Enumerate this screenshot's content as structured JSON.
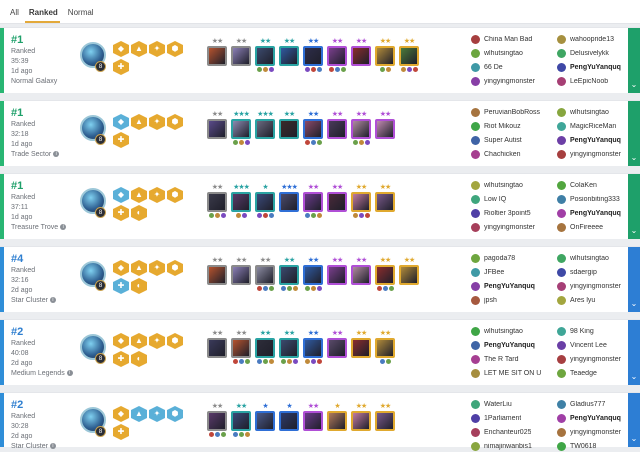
{
  "tabs": [
    "All",
    "Ranked",
    "Normal"
  ],
  "active_tab": 1,
  "colors": {
    "win": "#29b673",
    "loss": "#2f8ed8",
    "place_win": "#1ea06a",
    "place_loss": "#2f7fd0",
    "side_win": "#1ea06a",
    "side_loss": "#2d7ed4"
  },
  "matches": [
    {
      "place": "#1",
      "mode": "Ranked",
      "duration": "35:39",
      "ago": "1d ago",
      "galaxy": "Normal Galaxy",
      "galaxy_info": false,
      "result": "win",
      "level": "8",
      "traits": [
        {
          "icon": "hex-icon",
          "color": "#e6a92f"
        },
        {
          "icon": "hex-icon",
          "color": "#e6a92f"
        },
        {
          "icon": "hex-icon",
          "color": "#e6a92f"
        },
        {
          "icon": "hex-icon",
          "color": "#e6a92f"
        },
        {
          "icon": "hex-icon",
          "color": "#e6a92f"
        }
      ],
      "units": [
        {
          "stars": "★★",
          "color": "#8b8b8b",
          "portrait": "#b5532e",
          "items": 0
        },
        {
          "stars": "★★",
          "color": "#8b8b8b",
          "portrait": "#8a7fb5",
          "items": 0
        },
        {
          "stars": "★★",
          "color": "#2aa3a3",
          "portrait": "#3b4a6e",
          "items": 3
        },
        {
          "stars": "★★",
          "color": "#2aa3a3",
          "portrait": "#2f5aa0",
          "items": 0
        },
        {
          "stars": "★★",
          "color": "#2f6fd6",
          "portrait": "#2d2d4a",
          "items": 3
        },
        {
          "stars": "★★",
          "color": "#b04fd6",
          "portrait": "#7a3f8c",
          "items": 3
        },
        {
          "stars": "★★",
          "color": "#b04fd6",
          "portrait": "#8a2d2d",
          "items": 0
        },
        {
          "stars": "★★",
          "color": "#e0a92f",
          "portrait": "#b08a3a",
          "items": 2
        },
        {
          "stars": "★★",
          "color": "#e0a92f",
          "portrait": "#4a7a3a",
          "items": 3
        }
      ],
      "players": [
        {
          "name": "China Man Bad",
          "me": false
        },
        {
          "name": "wahoopride13",
          "me": false
        },
        {
          "name": "wlhutsingtao",
          "me": false
        },
        {
          "name": "Delusivelykk",
          "me": false
        },
        {
          "name": "66 De",
          "me": false
        },
        {
          "name": "PengYuYanquq",
          "me": true
        },
        {
          "name": "yingyingmonster",
          "me": false
        },
        {
          "name": "LeEpicNoob",
          "me": false
        }
      ]
    },
    {
      "place": "#1",
      "mode": "Ranked",
      "duration": "32:18",
      "ago": "1d ago",
      "galaxy": "Trade Sector",
      "galaxy_info": true,
      "result": "win",
      "level": "8",
      "traits": [
        {
          "icon": "hex-icon",
          "color": "#5ab0d8"
        },
        {
          "icon": "hex-icon",
          "color": "#e6a92f"
        },
        {
          "icon": "hex-icon",
          "color": "#e6a92f"
        },
        {
          "icon": "hex-icon",
          "color": "#e6a92f"
        },
        {
          "icon": "hex-icon",
          "color": "#e6a92f"
        }
      ],
      "units": [
        {
          "stars": "★★",
          "color": "#8b8b8b",
          "portrait": "#5a4a8a",
          "items": 0
        },
        {
          "stars": "★★★",
          "color": "#2aa3a3",
          "portrait": "#8a8ab0",
          "items": 3
        },
        {
          "stars": "★★★",
          "color": "#2aa3a3",
          "portrait": "#6a6a80",
          "items": 0
        },
        {
          "stars": "★★",
          "color": "#2aa3a3",
          "portrait": "#3a2a2a",
          "items": 0
        },
        {
          "stars": "★★",
          "color": "#2f6fd6",
          "portrait": "#8a4a6a",
          "items": 3
        },
        {
          "stars": "★★",
          "color": "#b04fd6",
          "portrait": "#4a3a5a",
          "items": 0
        },
        {
          "stars": "★★",
          "color": "#b04fd6",
          "portrait": "#b08aa0",
          "items": 3
        },
        {
          "stars": "★★",
          "color": "#b04fd6",
          "portrait": "#c08ab0",
          "items": 0
        }
      ],
      "players": [
        {
          "name": "PeruvianBobRoss",
          "me": false
        },
        {
          "name": "wlhutsingtao",
          "me": false
        },
        {
          "name": "Riot Mikouz",
          "me": false
        },
        {
          "name": "MagicRiceMan",
          "me": false
        },
        {
          "name": "Super Autist",
          "me": false
        },
        {
          "name": "PengYuYanquq",
          "me": true
        },
        {
          "name": "Chachicken",
          "me": false
        },
        {
          "name": "yingyingmonster",
          "me": false
        }
      ]
    },
    {
      "place": "#1",
      "mode": "Ranked",
      "duration": "37:11",
      "ago": "1d ago",
      "galaxy": "Treasure Trove",
      "galaxy_info": true,
      "result": "win",
      "level": "8",
      "traits": [
        {
          "icon": "hex-icon",
          "color": "#5ab0d8"
        },
        {
          "icon": "hex-icon",
          "color": "#e6a92f"
        },
        {
          "icon": "hex-icon",
          "color": "#e6a92f"
        },
        {
          "icon": "hex-icon",
          "color": "#e6a92f"
        },
        {
          "icon": "hex-icon",
          "color": "#e6a92f"
        },
        {
          "icon": "hex-icon",
          "color": "#e6a92f"
        }
      ],
      "units": [
        {
          "stars": "★★",
          "color": "#8b8b8b",
          "portrait": "#3a3a4a",
          "items": 3
        },
        {
          "stars": "★★★",
          "color": "#2aa3a3",
          "portrait": "#5a3a6a",
          "items": 2
        },
        {
          "stars": "★",
          "color": "#2aa3a3",
          "portrait": "#3a4a7a",
          "items": 3
        },
        {
          "stars": "★★★",
          "color": "#2f6fd6",
          "portrait": "#4a4a6a",
          "items": 0
        },
        {
          "stars": "★★",
          "color": "#b04fd6",
          "portrait": "#6a3a8a",
          "items": 3
        },
        {
          "stars": "★★",
          "color": "#b04fd6",
          "portrait": "#4a2a3a",
          "items": 0
        },
        {
          "stars": "★★",
          "color": "#e0a92f",
          "portrait": "#c07aa0",
          "items": 3
        },
        {
          "stars": "★★",
          "color": "#e0a92f",
          "portrait": "#7a5a8a",
          "items": 0
        }
      ],
      "players": [
        {
          "name": "wlhutsingtao",
          "me": false
        },
        {
          "name": "ColaKen",
          "me": false
        },
        {
          "name": "Low IQ",
          "me": false
        },
        {
          "name": "Posionbiting333",
          "me": false
        },
        {
          "name": "Rioltier 3point5",
          "me": false
        },
        {
          "name": "PengYuYanquq",
          "me": true
        },
        {
          "name": "yingyingmonster",
          "me": false
        },
        {
          "name": "OnFireeee",
          "me": false
        }
      ]
    },
    {
      "place": "#4",
      "mode": "Ranked",
      "duration": "32:16",
      "ago": "2d ago",
      "galaxy": "Star Cluster",
      "galaxy_info": true,
      "result": "loss",
      "level": "8",
      "traits": [
        {
          "icon": "hex-icon",
          "color": "#e6a92f"
        },
        {
          "icon": "hex-icon",
          "color": "#e6a92f"
        },
        {
          "icon": "hex-icon",
          "color": "#e6a92f"
        },
        {
          "icon": "hex-icon",
          "color": "#e6a92f"
        },
        {
          "icon": "hex-icon",
          "color": "#5ab0d8"
        },
        {
          "icon": "hex-icon",
          "color": "#e6a92f"
        }
      ],
      "units": [
        {
          "stars": "★★",
          "color": "#8b8b8b",
          "portrait": "#b5532e",
          "items": 0
        },
        {
          "stars": "★★",
          "color": "#8b8b8b",
          "portrait": "#8a7fb5",
          "items": 0
        },
        {
          "stars": "★★",
          "color": "#8b8b8b",
          "portrait": "#8a8aa0",
          "items": 3
        },
        {
          "stars": "★★",
          "color": "#2aa3a3",
          "portrait": "#3a4a6e",
          "items": 3
        },
        {
          "stars": "★★",
          "color": "#2f6fd6",
          "portrait": "#2f5aa0",
          "items": 3
        },
        {
          "stars": "★★",
          "color": "#b04fd6",
          "portrait": "#7a3f8c",
          "items": 0
        },
        {
          "stars": "★★",
          "color": "#b04fd6",
          "portrait": "#b08aa0",
          "items": 0
        },
        {
          "stars": "★★",
          "color": "#e0a92f",
          "portrait": "#8a2d2d",
          "items": 3
        },
        {
          "stars": "★★",
          "color": "#e0a92f",
          "portrait": "#b08a3a",
          "items": 0
        }
      ],
      "players": [
        {
          "name": "pagoda78",
          "me": false
        },
        {
          "name": "wlhutsingtao",
          "me": false
        },
        {
          "name": "JFBee",
          "me": false
        },
        {
          "name": "sdaergip",
          "me": false
        },
        {
          "name": "PengYuYanquq",
          "me": true
        },
        {
          "name": "yingyingmonster",
          "me": false
        },
        {
          "name": "jpsh",
          "me": false
        },
        {
          "name": "Ares lyu",
          "me": false
        }
      ]
    },
    {
      "place": "#2",
      "mode": "Ranked",
      "duration": "40:08",
      "ago": "2d ago",
      "galaxy": "Medium Legends",
      "galaxy_info": true,
      "result": "loss",
      "level": "8",
      "traits": [
        {
          "icon": "hex-icon",
          "color": "#e6a92f"
        },
        {
          "icon": "hex-icon",
          "color": "#e6a92f"
        },
        {
          "icon": "hex-icon",
          "color": "#e6a92f"
        },
        {
          "icon": "hex-icon",
          "color": "#e6a92f"
        },
        {
          "icon": "hex-icon",
          "color": "#e6a92f"
        },
        {
          "icon": "hex-icon",
          "color": "#e6a92f"
        }
      ],
      "units": [
        {
          "stars": "★★",
          "color": "#8b8b8b",
          "portrait": "#3a3a5a",
          "items": 0
        },
        {
          "stars": "★★",
          "color": "#8b8b8b",
          "portrait": "#b5532e",
          "items": 3
        },
        {
          "stars": "★★",
          "color": "#2aa3a3",
          "portrait": "#2d2d3a",
          "items": 3
        },
        {
          "stars": "★★",
          "color": "#2aa3a3",
          "portrait": "#3a4a6e",
          "items": 3
        },
        {
          "stars": "★★",
          "color": "#2f6fd6",
          "portrait": "#2f5aa0",
          "items": 3
        },
        {
          "stars": "★★",
          "color": "#b04fd6",
          "portrait": "#5a4a6a",
          "items": 0
        },
        {
          "stars": "★★",
          "color": "#e0a92f",
          "portrait": "#8a2d2d",
          "items": 0
        },
        {
          "stars": "★★",
          "color": "#e0a92f",
          "portrait": "#b08a3a",
          "items": 2
        }
      ],
      "players": [
        {
          "name": "wlhutsingtao",
          "me": false
        },
        {
          "name": "98 King",
          "me": false
        },
        {
          "name": "PengYuYanquq",
          "me": true
        },
        {
          "name": "Vincent Lee",
          "me": false
        },
        {
          "name": "The R Tard",
          "me": false
        },
        {
          "name": "yingyingmonster",
          "me": false
        },
        {
          "name": "LET ME SIT ON U",
          "me": false
        },
        {
          "name": "Teaedge",
          "me": false
        }
      ]
    },
    {
      "place": "#2",
      "mode": "Ranked",
      "duration": "30:28",
      "ago": "2d ago",
      "galaxy": "Star Cluster",
      "galaxy_info": true,
      "result": "loss",
      "level": "8",
      "traits": [
        {
          "icon": "hex-icon",
          "color": "#e6a92f"
        },
        {
          "icon": "hex-icon",
          "color": "#5ab0d8"
        },
        {
          "icon": "hex-icon",
          "color": "#5ab0d8"
        },
        {
          "icon": "hex-icon",
          "color": "#5ab0d8"
        },
        {
          "icon": "hex-icon",
          "color": "#e6a92f"
        }
      ],
      "units": [
        {
          "stars": "★★",
          "color": "#8b8b8b",
          "portrait": "#5a3a6a",
          "items": 3
        },
        {
          "stars": "★★",
          "color": "#2aa3a3",
          "portrait": "#3a4a7a",
          "items": 3
        },
        {
          "stars": "★",
          "color": "#2f6fd6",
          "portrait": "#4a5a8a",
          "items": 0
        },
        {
          "stars": "★",
          "color": "#2f6fd6",
          "portrait": "#2d3a6a",
          "items": 0
        },
        {
          "stars": "★★",
          "color": "#b04fd6",
          "portrait": "#6a3a8a",
          "items": 0
        },
        {
          "stars": "★",
          "color": "#e0a92f",
          "portrait": "#b07a5a",
          "items": 0
        },
        {
          "stars": "★★",
          "color": "#e0a92f",
          "portrait": "#c07aa0",
          "items": 0
        },
        {
          "stars": "★★",
          "color": "#e0a92f",
          "portrait": "#7a5a8a",
          "items": 0
        }
      ],
      "players": [
        {
          "name": "WaterLiu",
          "me": false
        },
        {
          "name": "Gladius777",
          "me": false
        },
        {
          "name": "1Parliament",
          "me": false
        },
        {
          "name": "PengYuYanquq",
          "me": true
        },
        {
          "name": "Enchanteur025",
          "me": false
        },
        {
          "name": "yingyingmonster",
          "me": false
        },
        {
          "name": "nimajinwanbis1",
          "me": false
        },
        {
          "name": "TW0618",
          "me": false
        }
      ]
    }
  ]
}
